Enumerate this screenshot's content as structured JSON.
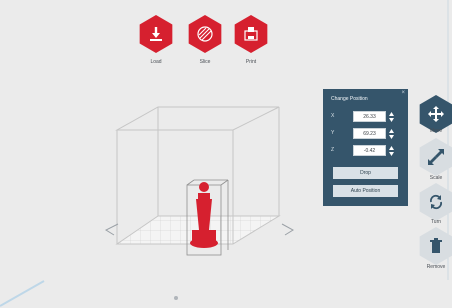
{
  "toolbar": {
    "load": {
      "label": "Load",
      "icon": "download-icon"
    },
    "slice": {
      "label": "Slice",
      "icon": "slice-icon"
    },
    "print": {
      "label": "Print",
      "icon": "print-icon"
    }
  },
  "panel": {
    "title": "Change Position",
    "close_label": "×",
    "fields": [
      {
        "axis": "X",
        "value": "26.33"
      },
      {
        "axis": "Y",
        "value": "69.23"
      },
      {
        "axis": "Z",
        "value": "-0.42"
      }
    ],
    "drop_label": "Drop",
    "auto_position_label": "Auto Position"
  },
  "side_tools": [
    {
      "label": "Move",
      "icon": "move-icon",
      "active": true
    },
    {
      "label": "Scale",
      "icon": "scale-icon",
      "active": false
    },
    {
      "label": "Turn",
      "icon": "turn-icon",
      "active": false
    },
    {
      "label": "Remove",
      "icon": "remove-icon",
      "active": false
    }
  ],
  "colors": {
    "accent_red": "#d6202f",
    "panel_blue": "#35556b",
    "viewport_bg": "#ebebeb"
  }
}
